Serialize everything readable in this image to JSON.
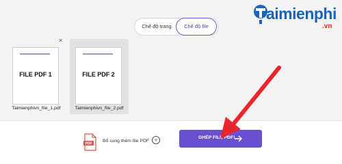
{
  "mode_toggle": {
    "page_mode": "Chế độ trang",
    "file_mode": "Chế độ file"
  },
  "files": [
    {
      "thumb_text": "FILE PDF 1",
      "name": "Taimienphivn_file_1.pdf"
    },
    {
      "thumb_text": "FILE PDF 2",
      "name": "Taimienphivn_file_2.pdf"
    }
  ],
  "remove_symbol": "×",
  "add_more": {
    "label": "Bổ sung thêm file PDF",
    "plus": "+"
  },
  "merge_button": {
    "label": "GHÉP FILE PDF!"
  },
  "logo": {
    "text": "aimienphi",
    "suffix": ".vn"
  },
  "colors": {
    "accent": "#6a4fd0",
    "annotation_arrow": "#e8262b",
    "logo_blue": "#1d63b8"
  }
}
